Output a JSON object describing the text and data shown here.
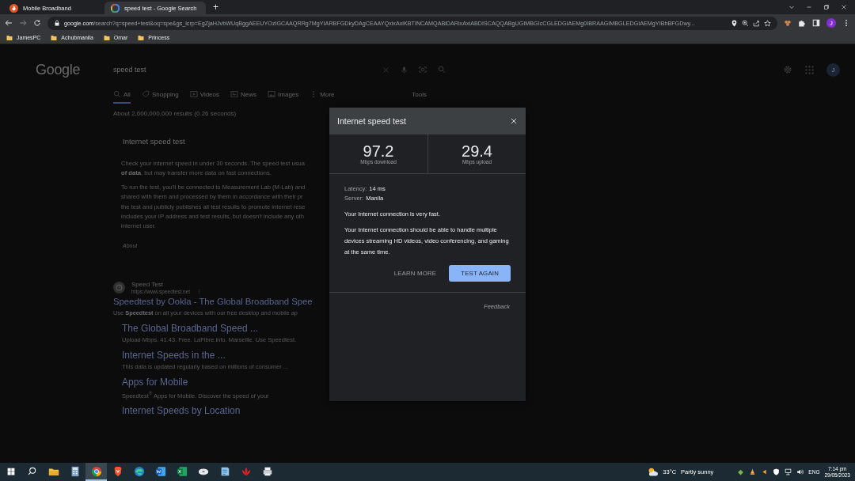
{
  "browser": {
    "tabs": [
      {
        "title": "Mobile Broadband",
        "kind": "broadband",
        "selected": false
      },
      {
        "title": "speed test - Google Search",
        "kind": "google",
        "selected": true
      }
    ],
    "new_tab": "+",
    "address": {
      "host": "google.com",
      "path": "/search?q=speed+test&oq=spe&gs_lcrp=EgZjaHJvbWUqBggAEEUYOzIGCAAQRRg7MgYIARBFGDkyDAgCEAAYQxixAxiKBTINCAMQABiDARixAxiABDISCAQQABgUGIMBGIcCGLEDGIAEMg0IBRAAGIMBGLEDGIAEMgYIBhBFGDwy..."
    },
    "profile": "J",
    "bookmarks": [
      "JamesPC",
      "Achubmanila",
      "Omar",
      "Princess"
    ]
  },
  "page": {
    "logo": "Google",
    "query": "speed test",
    "avatar": "J",
    "nav": [
      {
        "label": "All",
        "kind": "search",
        "selected": true
      },
      {
        "label": "Shopping",
        "kind": "tag",
        "selected": false
      },
      {
        "label": "Videos",
        "kind": "video",
        "selected": false
      },
      {
        "label": "News",
        "kind": "news",
        "selected": false
      },
      {
        "label": "Images",
        "kind": "image",
        "selected": false
      },
      {
        "label": "More",
        "kind": "more",
        "selected": false
      }
    ],
    "tools": "Tools",
    "stats": "About 2,600,000,000 results (0.26 seconds)",
    "featured": {
      "title": "Internet speed test",
      "paragraphs": [
        [
          "Check your internet speed in under 30 seconds. The speed test usua",
          "**of data**, but may transfer more data on fast connections."
        ],
        [
          "To run the test, you'll be connected to Measurement Lab (M-Lab) and",
          "shared with them and processed by them in accordance with their pr",
          "the test and publicly publishes all test results to promote internet rese",
          "includes your IP address and test results, but doesn't include any oth",
          "internet user."
        ]
      ],
      "about": "About"
    },
    "result": {
      "site": "Speed Test",
      "url": "https://www.speedtest.net",
      "title": "Speedtest by Ookla - The Global Broadband Spee",
      "snippet": "Use **Speedtest** on all your devices with our free desktop and mobile ap",
      "sitelinks": [
        {
          "title": "The Global Broadband Speed ...",
          "snippet": "Upload Mbps. 41.43. Free. LaFibre.info. Marseille. Use Speedtest."
        },
        {
          "title": "Internet Speeds in the ...",
          "snippet": "This data is updated regularly based on millions of consumer ..."
        },
        {
          "title": "Apps for Mobile",
          "snippet": "Speedtest$^{®}$ Apps for Mobile. Discover the speed of your"
        },
        {
          "title": "Internet Speeds by Location"
        }
      ]
    }
  },
  "dialog": {
    "title": "Internet speed test",
    "speeds": [
      {
        "value": "97.2",
        "unit": "Mbps download"
      },
      {
        "value": "29.4",
        "unit": "Mbps upload"
      }
    ],
    "details": [
      {
        "label": "Latency:",
        "value": "14 ms"
      },
      {
        "label": "Server:",
        "value": "Manila"
      }
    ],
    "verdict": "Your Internet connection is very fast.",
    "description": "Your Internet connection should be able to handle multiple devices streaming HD videos, video conferencing, and gaming at the same time.",
    "buttons": [
      {
        "label": "LEARN MORE",
        "kind": "text"
      },
      {
        "label": "TEST AGAIN",
        "kind": "filled"
      }
    ],
    "feedback": "Feedback"
  },
  "taskbar": {
    "apps": [
      {
        "kind": "explorer",
        "selected": false
      },
      {
        "kind": "calculator",
        "selected": false
      },
      {
        "kind": "chrome",
        "selected": true
      },
      {
        "kind": "brave",
        "selected": false
      },
      {
        "kind": "edge",
        "selected": false
      },
      {
        "kind": "word",
        "selected": false
      },
      {
        "kind": "excel",
        "selected": false
      },
      {
        "kind": "disk",
        "selected": false
      },
      {
        "kind": "notepad",
        "selected": false
      },
      {
        "kind": "flower",
        "selected": false
      },
      {
        "kind": "printer",
        "selected": false
      }
    ],
    "weather": {
      "temperature": "33°C",
      "condition": "Partly sunny"
    },
    "language": "ENG",
    "time": "7:14 pm",
    "date": "29/05/2023"
  }
}
